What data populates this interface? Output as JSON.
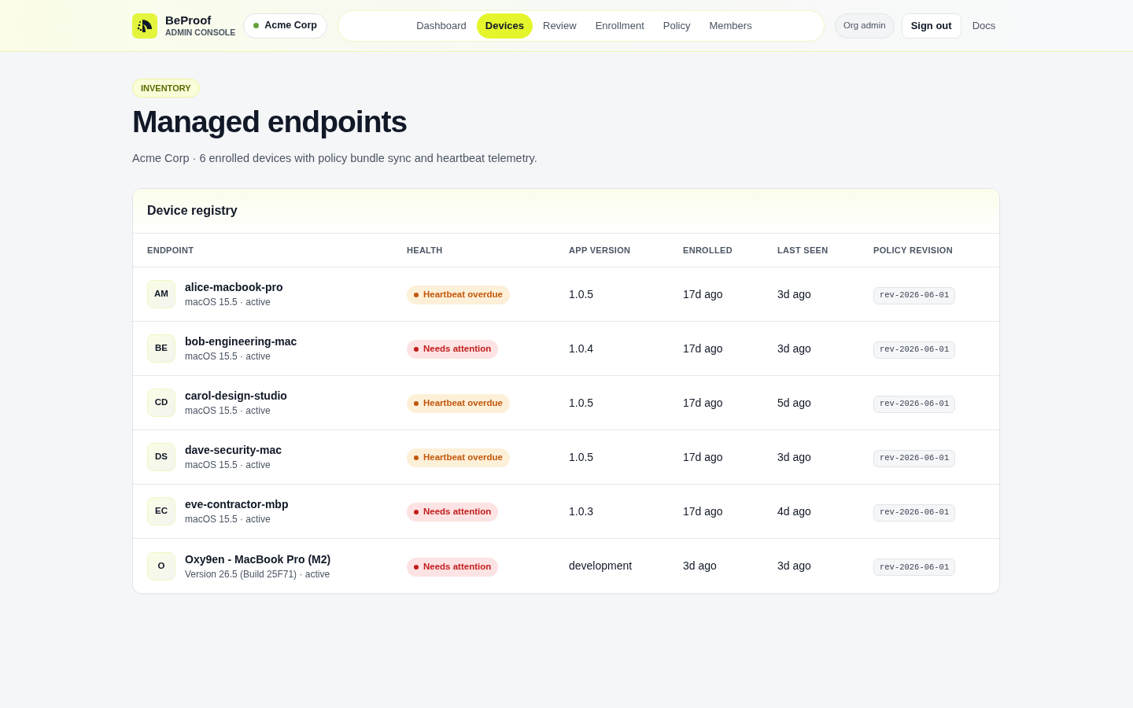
{
  "header": {
    "brand": {
      "name": "BeProof",
      "subtitle": "ADMIN CONSOLE"
    },
    "org": {
      "name": "Acme Corp",
      "online": true
    },
    "nav": [
      {
        "label": "Dashboard",
        "selected": false
      },
      {
        "label": "Devices",
        "selected": true
      },
      {
        "label": "Review",
        "selected": false
      },
      {
        "label": "Enrollment",
        "selected": false
      },
      {
        "label": "Policy",
        "selected": false
      },
      {
        "label": "Members",
        "selected": false
      }
    ],
    "role": "Org admin",
    "sign_out": "Sign out",
    "docs": "Docs"
  },
  "page": {
    "eyebrow": "INVENTORY",
    "title": "Managed endpoints",
    "subtitle": "Acme Corp · 6 enrolled devices with policy bundle sync and heartbeat telemetry."
  },
  "registry": {
    "title": "Device registry",
    "columns": [
      "ENDPOINT",
      "HEALTH",
      "APP VERSION",
      "ENROLLED",
      "LAST SEEN",
      "POLICY REVISION"
    ],
    "rows": [
      {
        "initials": "AM",
        "name": "alice-macbook-pro",
        "details": "macOS 15.5 · active",
        "health": {
          "label": "Heartbeat overdue",
          "kind": "overdue"
        },
        "app_version": "1.0.5",
        "enrolled": "17d ago",
        "last_seen": "3d ago",
        "policy_revision": "rev-2026-06-01"
      },
      {
        "initials": "BE",
        "name": "bob-engineering-mac",
        "details": "macOS 15.5 · active",
        "health": {
          "label": "Needs attention",
          "kind": "attention"
        },
        "app_version": "1.0.4",
        "enrolled": "17d ago",
        "last_seen": "3d ago",
        "policy_revision": "rev-2026-06-01"
      },
      {
        "initials": "CD",
        "name": "carol-design-studio",
        "details": "macOS 15.5 · active",
        "health": {
          "label": "Heartbeat overdue",
          "kind": "overdue"
        },
        "app_version": "1.0.5",
        "enrolled": "17d ago",
        "last_seen": "5d ago",
        "policy_revision": "rev-2026-06-01"
      },
      {
        "initials": "DS",
        "name": "dave-security-mac",
        "details": "macOS 15.5 · active",
        "health": {
          "label": "Heartbeat overdue",
          "kind": "overdue"
        },
        "app_version": "1.0.5",
        "enrolled": "17d ago",
        "last_seen": "3d ago",
        "policy_revision": "rev-2026-06-01"
      },
      {
        "initials": "EC",
        "name": "eve-contractor-mbp",
        "details": "macOS 15.5 · active",
        "health": {
          "label": "Needs attention",
          "kind": "attention"
        },
        "app_version": "1.0.3",
        "enrolled": "17d ago",
        "last_seen": "4d ago",
        "policy_revision": "rev-2026-06-01"
      },
      {
        "initials": "O",
        "name": "Oxy9en - MacBook Pro (M2)",
        "details": "Version 26.5 (Build 25F71) · active",
        "health": {
          "label": "Needs attention",
          "kind": "attention"
        },
        "app_version": "development",
        "enrolled": "3d ago",
        "last_seen": "3d ago",
        "policy_revision": "rev-2026-06-01"
      }
    ]
  }
}
